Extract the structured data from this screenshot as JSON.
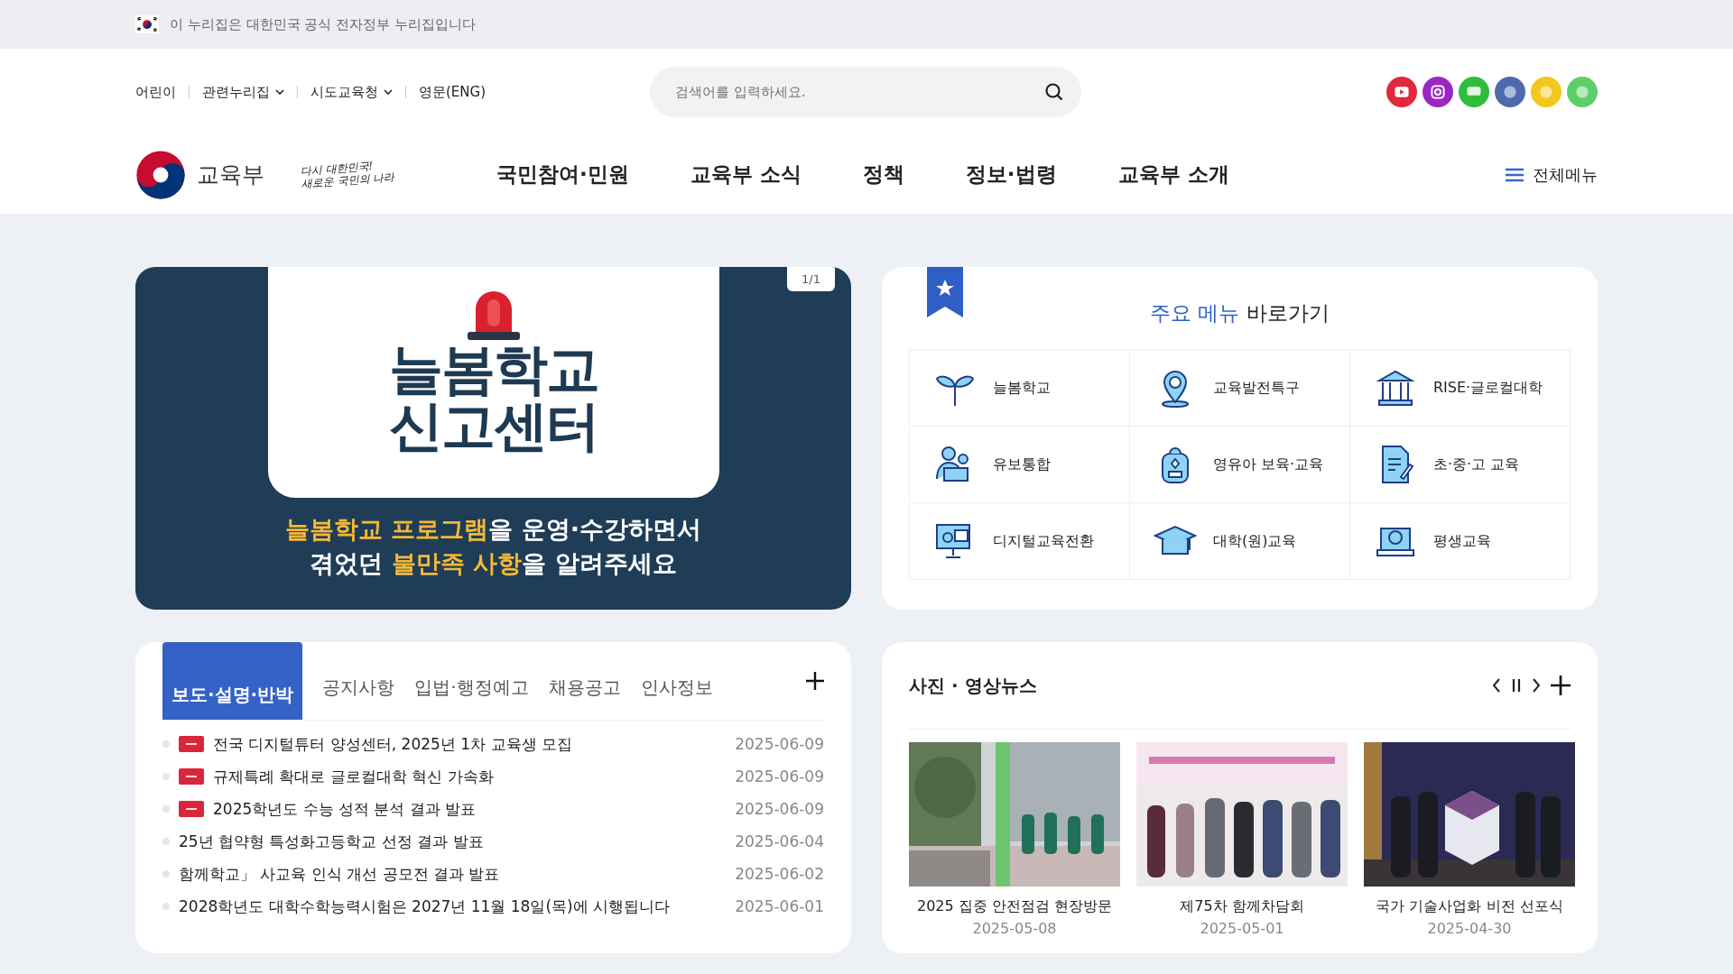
{
  "gov_bar": {
    "text": "이 누리집은 대한민국 공식 전자정부 누리집입니다"
  },
  "utility_links": [
    {
      "label": "어린이",
      "dropdown": false
    },
    {
      "label": "관련누리집",
      "dropdown": true
    },
    {
      "label": "시도교육청",
      "dropdown": true
    },
    {
      "label": "영문(ENG)",
      "dropdown": false
    }
  ],
  "search": {
    "placeholder": "검색어를 입력하세요."
  },
  "logo": {
    "name": "교육부",
    "slogan": [
      "다시 대한민국!",
      "새로운 국민의 나라"
    ]
  },
  "nav": [
    "국민참여·민원",
    "교육부 소식",
    "정책",
    "정보·법령",
    "교육부 소개"
  ],
  "all_menu": "전체메뉴",
  "banner": {
    "counter": "1/1",
    "title": [
      "늘봄학교",
      "신고센터"
    ],
    "lines": [
      [
        {
          "text": "늘봄학교 프로그램",
          "highlight": true
        },
        {
          "text": "을 운영·수강하면서",
          "highlight": false
        }
      ],
      [
        {
          "text": "겪었던 ",
          "highlight": false
        },
        {
          "text": "불만족 사항",
          "highlight": true
        },
        {
          "text": "을 알려주세요",
          "highlight": false
        }
      ]
    ]
  },
  "quick_menu": {
    "title_accent": "주요 메뉴",
    "title_rest": "바로가기",
    "items": [
      "늘봄학교",
      "교육발전특구",
      "RISE·글로컬대학",
      "유보통합",
      "영유아 보육·교육",
      "초·중·고 교육",
      "디지털교육전환",
      "대학(원)교육",
      "평생교육"
    ]
  },
  "news": {
    "tabs": [
      {
        "label": "보도·설명·반박",
        "selected": true
      },
      {
        "label": "공지사항",
        "selected": false
      },
      {
        "label": "입법·행정예고",
        "selected": false
      },
      {
        "label": "채용공고",
        "selected": false
      },
      {
        "label": "인사정보",
        "selected": false
      }
    ],
    "items": [
      {
        "title": "전국 디지털튜터 양성센터, 2025년 1차 교육생 모집",
        "date": "2025-06-09",
        "new": true
      },
      {
        "title": "규제특례 확대로 글로컬대학 혁신 가속화",
        "date": "2025-06-09",
        "new": true
      },
      {
        "title": "2025학년도 수능 성적 분석 결과 발표",
        "date": "2025-06-09",
        "new": true
      },
      {
        "title": "25년 협약형 특성화고등학교 선정 결과 발표",
        "date": "2025-06-04",
        "new": false
      },
      {
        "title": "함께학교」 사교육 인식 개선 공모전 결과 발표",
        "date": "2025-06-02",
        "new": false
      },
      {
        "title": "2028학년도 대학수학능력시험은 2027년 11월 18일(목)에 시행됩니다",
        "date": "2025-06-01",
        "new": false
      }
    ]
  },
  "photo_news": {
    "title": "사진 · 영상뉴스",
    "items": [
      {
        "kind": "picture",
        "caption": "2025 집중 안전점검 현장방문",
        "date": "2025-05-08"
      },
      {
        "kind": "picture",
        "caption": "제75차 함께차담회",
        "date": "2025-05-01"
      },
      {
        "kind": "picture",
        "caption": "국가 기술사업화 비전 선포식",
        "date": "2025-04-30"
      }
    ]
  }
}
